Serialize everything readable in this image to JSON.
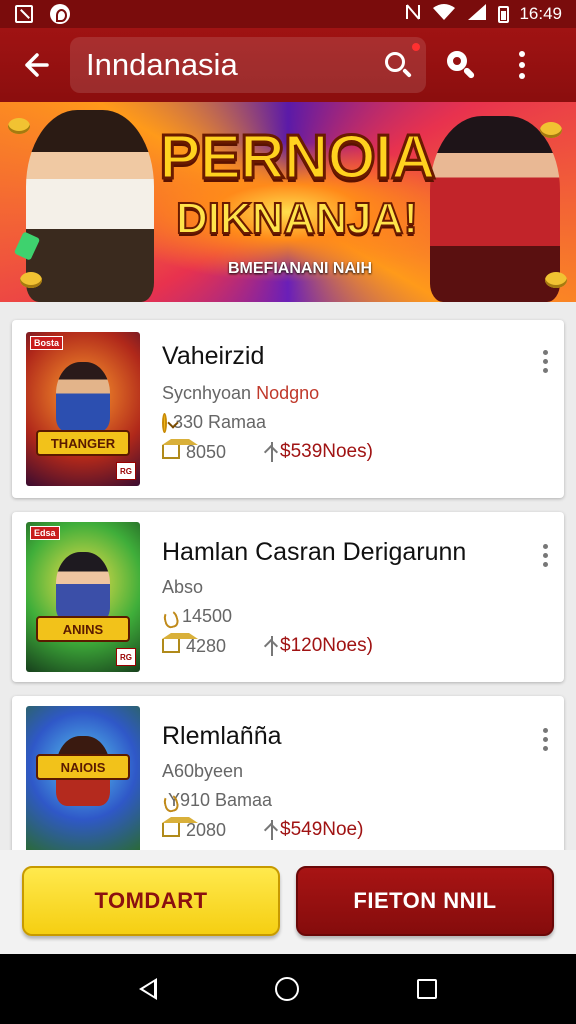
{
  "status_bar": {
    "time": "16:49"
  },
  "app_bar": {
    "title": "Inndanasia"
  },
  "banner": {
    "title_line1": "PERNOIA",
    "title_line2": "DIKNANJA!",
    "subtitle": "BMEFIANANI NAIH"
  },
  "games": [
    {
      "name": "Vaheirzid",
      "subtitle": "Sycnhyoan",
      "subtitle_accent": "Nodgno",
      "stat1": "330 Ramaa",
      "players": "8050",
      "price": "$539Noes)",
      "thumb_logo": "THANGER",
      "thumb_tag": "Bosta",
      "thumb_rating": "RG"
    },
    {
      "name": "Hamlan Casran Derigarunn",
      "subtitle": "Abso",
      "subtitle_accent": "",
      "stat1": "14500",
      "players": "4280",
      "price": "$120Noes)",
      "thumb_logo": "ANINS",
      "thumb_tag": "Edsa",
      "thumb_rating": "RG"
    },
    {
      "name": "Rlemlañña",
      "subtitle": "A60byeen",
      "subtitle_accent": "",
      "stat1": "Y910 Bamaa",
      "players": "2080",
      "price": "$549Noe)",
      "thumb_logo": "NAIOIS",
      "thumb_tag": "",
      "thumb_rating": ""
    }
  ],
  "buttons": {
    "primary": "TOMDART",
    "secondary": "FIETON NNIL"
  },
  "colors": {
    "brand_red": "#8b0e0e",
    "accent_yellow": "#f5cf12",
    "price_red": "#a01313"
  }
}
